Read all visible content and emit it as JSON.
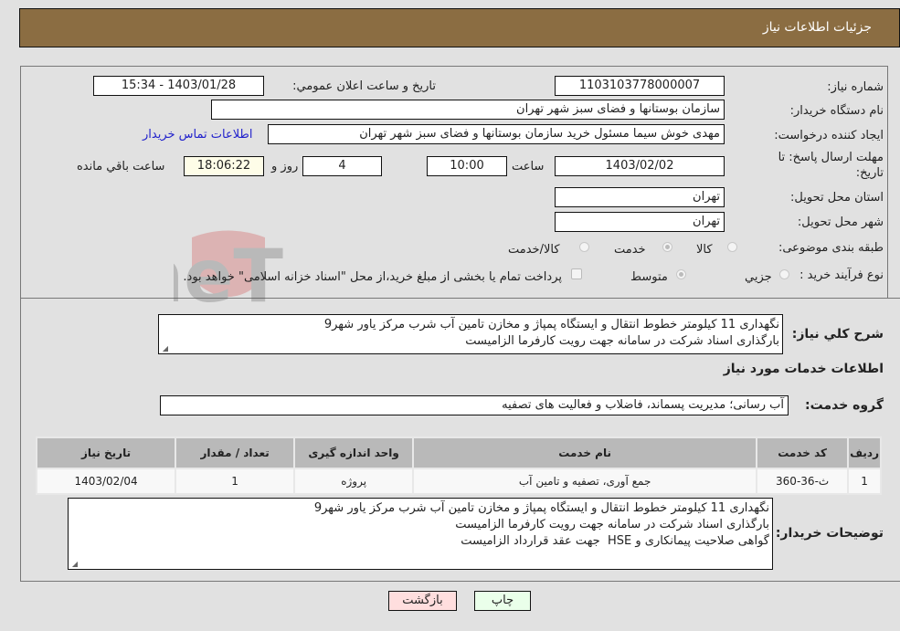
{
  "header": {
    "title": "جزئیات اطلاعات نیاز"
  },
  "form": {
    "need_number": {
      "label": "شماره نیاز:",
      "value": "1103103778000007"
    },
    "announce_datetime": {
      "label": "تاریخ و ساعت اعلان عمومي:",
      "value": "1403/01/28 - 15:34"
    },
    "buyer_org": {
      "label": "نام دستگاه خریدار:",
      "value": "سازمان بوستانها و فضای سبز شهر تهران"
    },
    "requester": {
      "label": "ایجاد کننده درخواست:",
      "value": "مهدی خوش سیما مسئول خرید سازمان بوستانها و فضای سبز شهر تهران"
    },
    "contact_link": "اطلاعات تماس خریدار",
    "deadline": {
      "label_line1": "مهلت ارسال پاسخ: تا",
      "label_line2": "تاریخ:",
      "date": "1403/02/02",
      "time_label": "ساعت",
      "time": "10:00",
      "days": "4",
      "days_label": "روز و",
      "remaining": "18:06:22",
      "remaining_label": "ساعت باقي مانده"
    },
    "province": {
      "label": "استان محل تحویل:",
      "value": "تهران"
    },
    "city": {
      "label": "شهر محل تحویل:",
      "value": "تهران"
    },
    "category": {
      "label": "طبقه بندی موضوعی:",
      "options": [
        "کالا",
        "خدمت",
        "کالا/خدمت"
      ],
      "selected": "خدمت"
    },
    "process": {
      "label": "نوع فرآیند خرید :",
      "options": [
        "جزيي",
        "متوسط"
      ],
      "selected": "متوسط",
      "payment_note": "پرداخت تمام یا بخشی از مبلغ خرید،از محل \"اسناد خزانه اسلامی\" خواهد بود."
    }
  },
  "description": {
    "label": "شرح کلي نیاز:",
    "lines": [
      "نگهداری 11 کیلومتر خطوط انتقال و ایستگاه پمپاژ و مخازن تامین آب شرب مرکز یاور شهر9",
      "بارگذاری اسناد شرکت در سامانه جهت رویت کارفرما الزامیست"
    ]
  },
  "services": {
    "section_title": "اطلاعات خدمات مورد نیاز",
    "group_label": "گروه خدمت:",
    "group_value": "آب رسانی؛ مدیریت پسماند، فاضلاب و فعالیت های تصفیه",
    "columns": [
      "ردیف",
      "کد خدمت",
      "نام خدمت",
      "واحد اندازه گیری",
      "تعداد / مقدار",
      "تاریخ نیاز"
    ],
    "rows": [
      [
        "1",
        "ث-36-360",
        "جمع آوری، تصفیه و تامین آب",
        "پروژه",
        "1",
        "1403/02/04"
      ]
    ]
  },
  "buyer_notes": {
    "label": "توضیحات خریدار:",
    "lines": [
      "نگهداری 11 کیلومتر خطوط انتقال و ایستگاه پمپاژ و مخازن تامین آب شرب مرکز یاور شهر9",
      "بارگذاری اسناد شرکت در سامانه جهت رویت کارفرما الزامیست",
      "گواهی صلاحیت پیمانکاری و HSE  جهت عقد قرارداد الزامیست"
    ]
  },
  "buttons": {
    "print": "چاپ",
    "back": "بازگشت"
  },
  "watermark": {
    "text": "AriaTender.neT"
  },
  "colors": {
    "header_bg": "#8b6d42",
    "print_bg": "#eaffea",
    "back_bg": "#ffdede",
    "link": "#2222cc"
  }
}
